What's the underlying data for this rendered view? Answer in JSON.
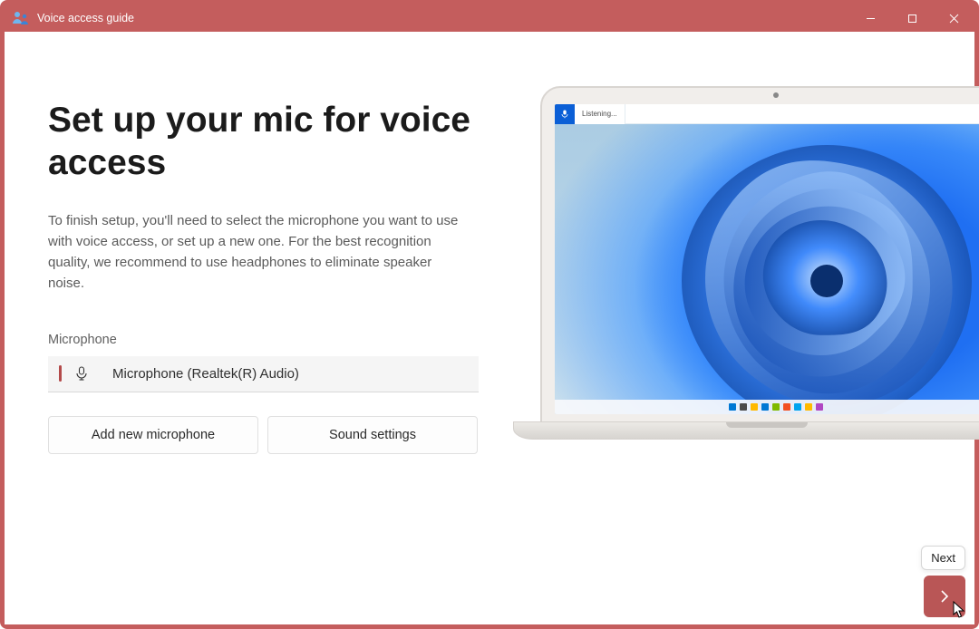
{
  "window": {
    "title": "Voice access guide"
  },
  "page": {
    "heading": "Set up your mic for voice access",
    "description": "To finish setup, you'll need to select the microphone you want to use with voice access, or set up a new one. For the best recognition quality, we recommend to use headphones to eliminate speaker noise.",
    "field_label": "Microphone"
  },
  "mic": {
    "selected": "Microphone (Realtek(R) Audio)"
  },
  "buttons": {
    "add_new": "Add new microphone",
    "sound_settings": "Sound settings"
  },
  "illustration": {
    "voice_bar_status": "Listening..."
  },
  "nav": {
    "next_tooltip": "Next"
  },
  "colors": {
    "accent": "#c45d5d",
    "next_btn": "#b95656",
    "voice_bar_mic": "#0b5fd6"
  }
}
